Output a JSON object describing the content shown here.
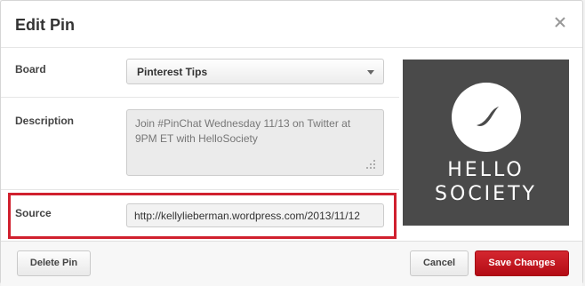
{
  "dialog": {
    "title": "Edit Pin",
    "close_icon": "close-icon"
  },
  "board": {
    "label": "Board",
    "selected": "Pinterest Tips"
  },
  "description": {
    "label": "Description",
    "value": "Join #PinChat Wednesday 11/13 on Twitter at 9PM ET with HelloSociety"
  },
  "source": {
    "label": "Source",
    "value": "http://kellylieberman.wordpress.com/2013/11/12",
    "highlight_color": "#d0202e"
  },
  "pin_image": {
    "line1": "HELLO",
    "line2": "SOCIETY",
    "background": "#4a4a4a"
  },
  "footer": {
    "delete_label": "Delete Pin",
    "cancel_label": "Cancel",
    "save_label": "Save Changes",
    "save_color": "#c11a22"
  }
}
